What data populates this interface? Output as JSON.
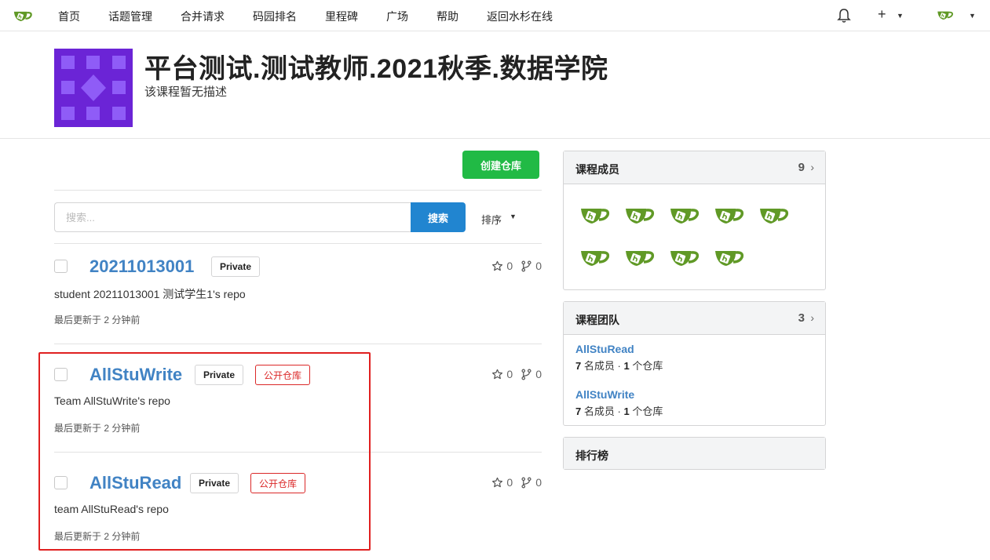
{
  "nav": {
    "items": [
      "首页",
      "话题管理",
      "合并请求",
      "码园排名",
      "里程碑",
      "广场",
      "帮助",
      "返回水杉在线"
    ],
    "plus_label": "+",
    "caret": "▼"
  },
  "course": {
    "title": "平台测试.测试教师.2021秋季.数据学院",
    "description": "该课程暂无描述"
  },
  "toolbar": {
    "create_label": "创建仓库",
    "search_placeholder": "搜索...",
    "search_label": "搜索",
    "sort_label": "排序"
  },
  "repos": [
    {
      "name": "20211013001",
      "private_label": "Private",
      "public_label": "",
      "stars": "0",
      "forks": "0",
      "description": "student 20211013001 测试学生1's repo",
      "updated": "最后更新于 2 分钟前"
    },
    {
      "name": "AllStuWrite",
      "private_label": "Private",
      "public_label": "公开仓库",
      "stars": "0",
      "forks": "0",
      "description": "Team AllStuWrite's repo",
      "updated": "最后更新于 2 分钟前"
    },
    {
      "name": "AllStuRead",
      "private_label": "Private",
      "public_label": "公开仓库",
      "stars": "0",
      "forks": "0",
      "description": "team AllStuRead's repo",
      "updated": "最后更新于 2 分钟前"
    }
  ],
  "sidebar": {
    "members": {
      "title": "课程成员",
      "count": "9",
      "avatar_icon": "gitea-teacup-icon"
    },
    "teams": {
      "title": "课程团队",
      "count": "3",
      "items": [
        {
          "name": "AllStuRead",
          "members": "7",
          "members_unit": "名成员",
          "sep": "·",
          "repos": "1",
          "repos_unit": "个仓库"
        },
        {
          "name": "AllStuWrite",
          "members": "7",
          "members_unit": "名成员",
          "sep": "·",
          "repos": "1",
          "repos_unit": "个仓库"
        }
      ]
    },
    "ranking": {
      "title": "排行榜"
    }
  },
  "colors": {
    "accent_green": "#21ba45",
    "accent_blue": "#2185d0",
    "link": "#4183c4",
    "logo_green": "#609926",
    "course_purple": "#6b24d6",
    "highlight_red": "#e02020"
  }
}
